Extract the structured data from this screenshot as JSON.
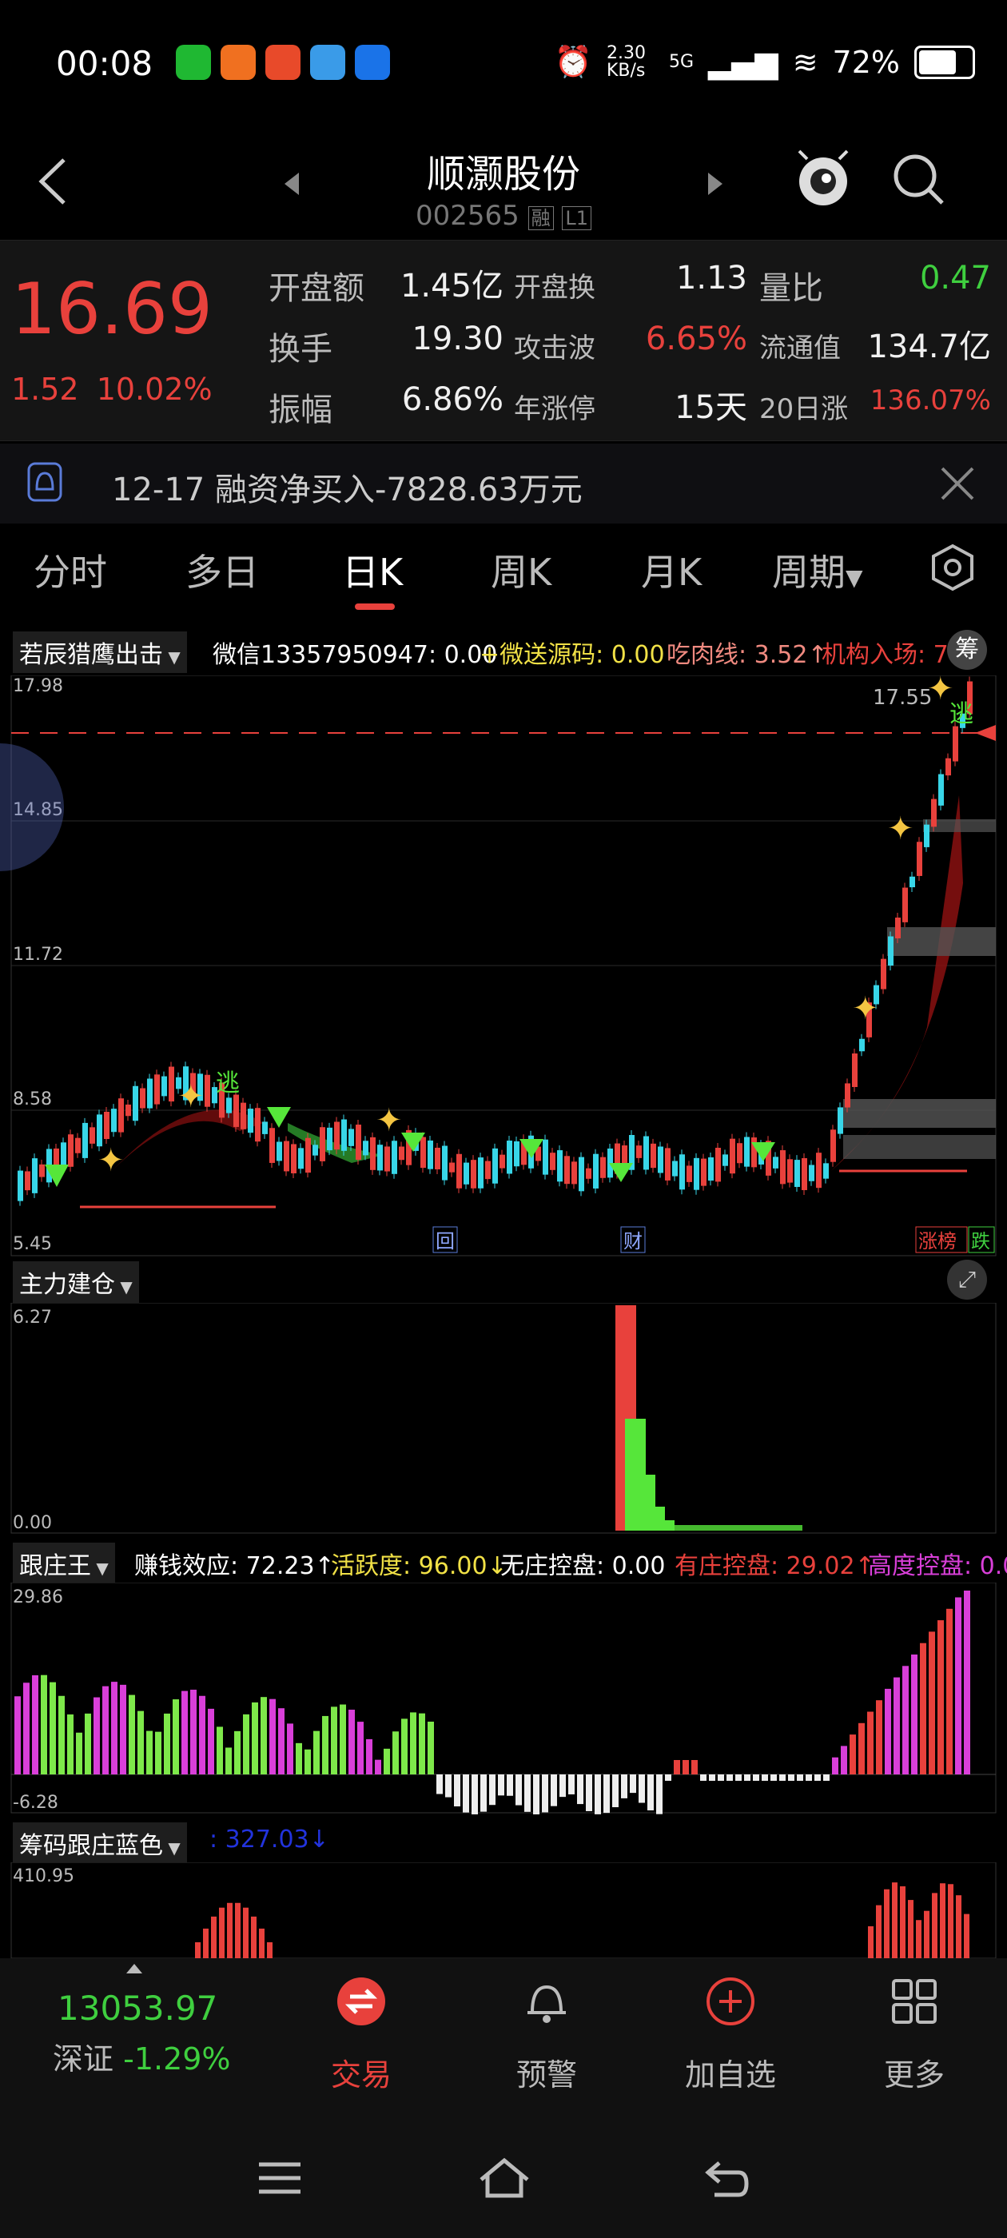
{
  "status_bar": {
    "time": "00:08",
    "net_speed": "2.30 KB/s",
    "signal": "5G",
    "battery": "72%"
  },
  "header": {
    "title": "顺灏股份",
    "code": "002565",
    "badge1": "融",
    "badge2": "L1"
  },
  "quote": {
    "price": "16.69",
    "change": "1.52",
    "change_pct": "10.02%",
    "rows": [
      [
        {
          "label": "开盘额",
          "value": "1.45亿"
        },
        {
          "label": "开盘换",
          "value": "1.13"
        },
        {
          "label": "量比",
          "value": "0.47"
        }
      ],
      [
        {
          "label": "换手",
          "value": "19.30"
        },
        {
          "label": "攻击波",
          "value": "6.65%"
        },
        {
          "label": "流通值",
          "value": "134.7亿"
        }
      ],
      [
        {
          "label": "振幅",
          "value": "6.86%"
        },
        {
          "label": "年涨停",
          "value": "15天"
        },
        {
          "label": "20日涨",
          "value": "136.07%"
        }
      ]
    ]
  },
  "notice": {
    "text": "12-17 融资净买入-7828.63万元"
  },
  "tabs": [
    "分时",
    "多日",
    "日K",
    "周K",
    "月K",
    "周期"
  ],
  "main_panel": {
    "indicator_name": "若辰猎鹰出击",
    "line1": "微信13357950947: 0.00",
    "line2": "+微送源码: 0.00",
    "line3": "吃肉线: 3.52↑",
    "line4": "机构入场: 7",
    "badge": "筹",
    "y_ticks": [
      "17.98",
      "14.85",
      "11.72",
      "8.58",
      "5.45"
    ],
    "price_marker": "17.55",
    "markers": [
      "回",
      "财",
      "涨榜",
      "跌"
    ],
    "tag_escape": "逃"
  },
  "panel2": {
    "name": "主力建仓",
    "y_top": "6.27",
    "y_bottom": "0.00"
  },
  "panel3": {
    "name": "跟庄王",
    "v1": "赚钱效应: 72.23↑",
    "v2": "活跃度: 96.00↓",
    "v3": "无庄控盘: 0.00",
    "v4": "有庄控盘: 29.02↑",
    "v5": "高度控盘: 0.0",
    "y_top": "29.86",
    "y_bottom": "-6.28"
  },
  "panel4": {
    "name": "筹码跟庄蓝色",
    "v1": ": 327.03↓",
    "y_top": "410.95"
  },
  "bottom": {
    "index_value": "13053.97",
    "index_name": "深证",
    "index_change": "-1.29%",
    "nav": [
      "交易",
      "预警",
      "加自选",
      "更多"
    ]
  },
  "colors": {
    "up": "#e8413c",
    "down": "#3fcf3f",
    "cyan": "#38d6e8",
    "magenta": "#d93fd9",
    "background": "#000000"
  }
}
